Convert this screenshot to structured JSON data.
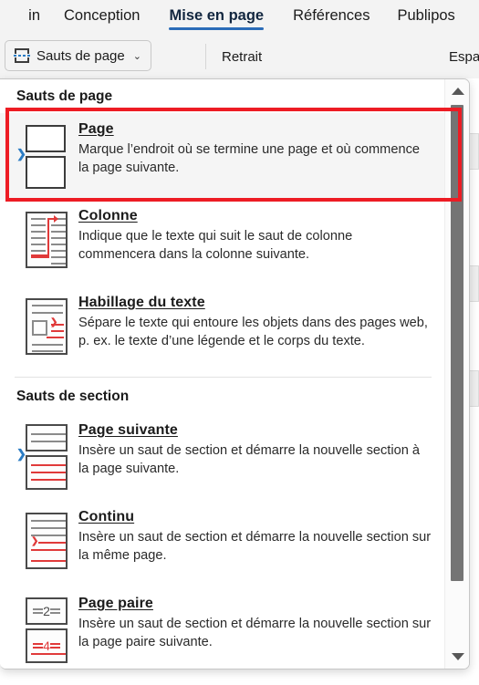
{
  "ribbon": {
    "tabs": [
      {
        "label": "in",
        "active": false
      },
      {
        "label": "Conception",
        "active": false
      },
      {
        "label": "Mise en page",
        "active": true
      },
      {
        "label": "Références",
        "active": false
      },
      {
        "label": "Publipos",
        "active": false
      }
    ],
    "breaks_button": {
      "label": "Sauts de page",
      "chevron": "⌄",
      "icon": "page-break-icon"
    },
    "group_labels": [
      {
        "label": "Retrait"
      },
      {
        "label": "Espac"
      }
    ]
  },
  "dropdown": {
    "groups": [
      {
        "header": "Sauts de page",
        "items": [
          {
            "title_prefix": "",
            "title_accel": "P",
            "title_suffix": "age",
            "title": "Page",
            "desc": "Marque l’endroit où se termine une page et où commence la page suivante.",
            "icon": "page-break-icon",
            "highlighted": true
          },
          {
            "title_prefix": "",
            "title_accel": "C",
            "title_suffix": "olonne",
            "title": "Colonne",
            "desc": "Indique que le texte qui suit le saut de colonne commencera dans la colonne suivante.",
            "icon": "column-break-icon",
            "highlighted": false
          },
          {
            "title_prefix": "Habillage du ",
            "title_accel": "t",
            "title_suffix": "exte",
            "title": "Habillage du texte",
            "desc": "Sépare le texte qui entoure les objets dans des pages web, p. ex. le texte d’une légende et le corps du texte.",
            "icon": "text-wrapping-break-icon",
            "highlighted": false
          }
        ]
      },
      {
        "header": "Sauts de section",
        "items": [
          {
            "title_prefix": "Page suiva",
            "title_accel": "n",
            "title_suffix": "te",
            "title": "Page suivante",
            "desc": "Insère un saut de section et démarre la nouvelle section à la page suivante.",
            "icon": "next-page-section-icon",
            "highlighted": false
          },
          {
            "title_prefix": "C",
            "title_accel": "o",
            "title_suffix": "ntinu",
            "title": "Continu",
            "desc": "Insère un saut de section et démarre la nouvelle section sur la même page.",
            "icon": "continuous-section-icon",
            "highlighted": false
          },
          {
            "title_prefix": "Page pair",
            "title_accel": "e",
            "title_suffix": "",
            "title": "Page paire",
            "desc": "Insère un saut de section et démarre la nouvelle section sur la page paire suivante.",
            "icon": "even-page-section-icon",
            "highlighted": false
          }
        ]
      }
    ],
    "scrollbar": {
      "up_arrow": "▲",
      "down_arrow": "▼"
    }
  },
  "annotation": {
    "highlight_color": "#ed1c24",
    "target": "Page"
  },
  "icon_text": {
    "even_num_gray": "2",
    "even_num_red": "4",
    "chevron_red": "❯",
    "chevron_blue": "❯"
  }
}
